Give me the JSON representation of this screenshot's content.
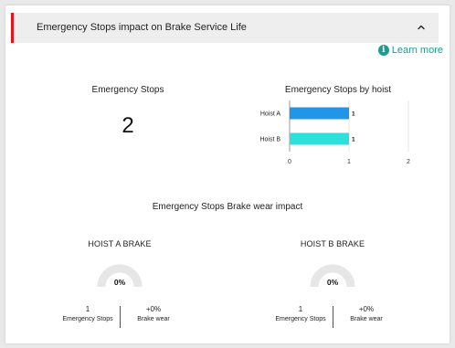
{
  "panel": {
    "title": "Emergency Stops impact on Brake Service Life",
    "chevron_icon": "chevron-up-icon",
    "accent_color": "#e4151f"
  },
  "learn_more": {
    "icon": "info-icon",
    "icon_glyph": "i",
    "label": "Learn more",
    "color": "#1b9e8d"
  },
  "emergency_stops": {
    "title": "Emergency Stops",
    "value": "2"
  },
  "hoist_chart": {
    "title": "Emergency Stops by hoist"
  },
  "chart_data": {
    "type": "bar",
    "orientation": "horizontal",
    "title": "Emergency Stops by hoist",
    "categories": [
      "Hoist A",
      "Hoist B"
    ],
    "values": [
      1,
      1
    ],
    "data_labels": [
      "1",
      "1"
    ],
    "colors": [
      "#2196e8",
      "#2ee0dc"
    ],
    "xlim": [
      0,
      2
    ],
    "x_ticks": [
      "0",
      "1",
      "2"
    ],
    "grid": true
  },
  "impact": {
    "title": "Emergency Stops Brake wear impact"
  },
  "brakes": [
    {
      "title": "HOIST A BRAKE",
      "percent": "0%",
      "wear_fraction": 0,
      "stops_value": "1",
      "stops_label": "Emergency Stops",
      "wear_value": "+0%",
      "wear_label": "Brake wear"
    },
    {
      "title": "HOIST B BRAKE",
      "percent": "0%",
      "wear_fraction": 0,
      "stops_value": "1",
      "stops_label": "Emergency Stops",
      "wear_value": "+0%",
      "wear_label": "Brake wear"
    }
  ]
}
